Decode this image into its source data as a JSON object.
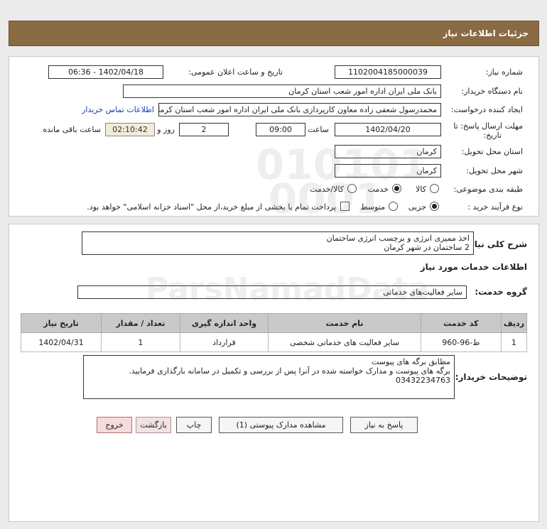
{
  "header": {
    "title": "جزئیات اطلاعات نیاز"
  },
  "form": {
    "need_number_label": "شماره نیاز:",
    "need_number": "1102004185000039",
    "announce_label": "تاریخ و ساعت اعلان عمومی:",
    "announce_value": "1402/04/18 - 06:36",
    "buyer_org_label": "نام دستگاه خریدار:",
    "buyer_org": "بانک ملی ایران اداره امور شعب استان کرمان",
    "creator_label": "ایجاد کننده درخواست:",
    "creator": "محمدرسول شعفی زاده معاون کارپردازی بانک ملی ایران اداره امور شعب استان کرمان",
    "contact_link": "اطلاعات تماس خریدار",
    "deadline_label_1": "مهلت ارسال پاسخ: تا",
    "deadline_label_2": "تاریخ:",
    "deadline_date": "1402/04/20",
    "time_label": "ساعت",
    "deadline_time": "09:00",
    "days_value": "2",
    "days_label": "روز و",
    "remaining_time": "02:10:42",
    "remaining_label": "ساعت باقی مانده",
    "province_label": "استان محل تحویل:",
    "province": "کرمان",
    "city_label": "شهر محل تحویل:",
    "city": "کرمان",
    "category_label": "طبقه بندی موضوعی:",
    "category_options": [
      "کالا",
      "خدمت",
      "کالا/خدمت"
    ],
    "category_selected": "خدمت",
    "purchase_type_label": "نوع فرآیند خرید :",
    "purchase_options": [
      "جزیی",
      "متوسط"
    ],
    "purchase_selected": "جزیی",
    "payment_note": "پرداخت تمام یا بخشی از مبلغ خرید،از محل \"اسناد خزانه اسلامی\" خواهد بود."
  },
  "description": {
    "label": "شرح کلی نیاز:",
    "text": "اخذ ممیزی انرژی و برچسب انرژی ساختمان\n2 ساختمان در شهر کرمان"
  },
  "services": {
    "section_title": "اطلاعات خدمات مورد نیاز",
    "group_label": "گروه خدمت:",
    "group_value": "سایر فعالیت‌های خدماتی",
    "columns": [
      "ردیف",
      "کد خدمت",
      "نام خدمت",
      "واحد اندازه گیری",
      "تعداد / مقدار",
      "تاریخ نیاز"
    ],
    "rows": [
      [
        "1",
        "ط-96-960",
        "سایر فعالیت های خدماتی شخصی",
        "قرارداد",
        "1",
        "1402/04/31"
      ]
    ]
  },
  "buyer_notes": {
    "label": "توضیحات خریدار:",
    "text": "مطابق برگه های پیوست\nبرگه های پیوست و مدارک خواسته شده در آنرا پس از بررسی و تکمیل در سامانه بارگذاری فرمایید.\n03432234763"
  },
  "buttons": {
    "reply": "پاسخ به نیاز",
    "attachments": "مشاهده مدارک پیوستی (1)",
    "print": "چاپ",
    "back": "بازگشت",
    "exit": "خروج"
  },
  "colors": {
    "header_bg": "#8a6a43",
    "link": "#1a3fa6",
    "table_header": "#c9c9c9",
    "timer_bg": "#f2ecd8"
  }
}
